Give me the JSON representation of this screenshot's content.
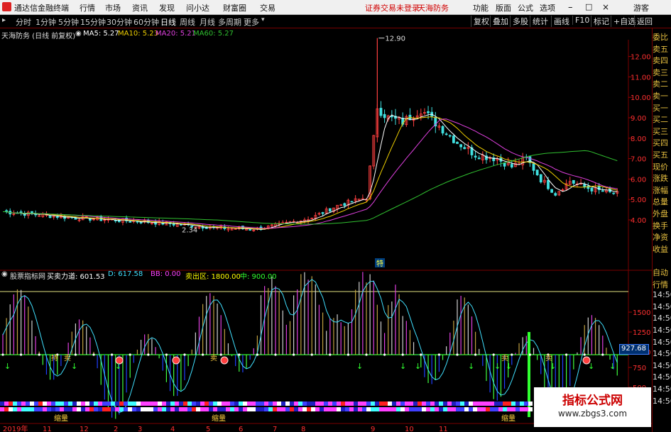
{
  "menu": {
    "app_name": "通达信金融终端",
    "items_left": [
      "行情",
      "市场",
      "资讯",
      "发现",
      "问小达",
      "财富圈",
      "交易"
    ],
    "notice": "证券交易未登录",
    "stock_name_top": "天海防务",
    "items_right": [
      "功能",
      "版面",
      "公式",
      "选项"
    ],
    "guest": "游客"
  },
  "periods": [
    "分时",
    "1分钟",
    "5分钟",
    "15分钟",
    "30分钟",
    "60分钟",
    "日线",
    "周线",
    "月线",
    "多周期",
    "更多"
  ],
  "active_period": "日线",
  "right_tools": [
    "复权",
    "叠加",
    "多股",
    "统计",
    "画线",
    "F10",
    "标记",
    "+自选",
    "返回"
  ],
  "main_chart": {
    "title": "天海防务 (日线 前复权)",
    "ma": [
      {
        "label": "MA5: 5.27",
        "color": "#ffffff"
      },
      {
        "label": "MA10: 5.23",
        "color": "#f0d000"
      },
      {
        "label": "MA20: 5.21",
        "color": "#e040e0"
      },
      {
        "label": "MA60: 5.27",
        "color": "#30c030"
      }
    ],
    "price_ticks": [
      "12.00",
      "11.00",
      "10.00",
      "9.00",
      "8.00",
      "7.00",
      "6.00",
      "5.00",
      "4.00"
    ],
    "high_label": "12.90",
    "low_label": "2.34",
    "event_label": "特"
  },
  "indicator": {
    "title": "股票指标网",
    "fields": [
      {
        "label": "买卖力道: 601.53",
        "color": "#ffffff"
      },
      {
        "label": "D: 617.58",
        "color": "#40e0ff"
      },
      {
        "label": "BB: 0.00",
        "color": "#ff40ff"
      },
      {
        "label": "卖出区: 1800.00",
        "color": "#ffff00"
      },
      {
        "label": "中: 900.00",
        "color": "#30ff30"
      }
    ],
    "value_ticks": [
      "1500",
      "1250",
      "1000",
      "750",
      "500"
    ],
    "current_value": "927.68",
    "signal_buy": "买",
    "signal_sell": "卖",
    "signal_hold": "持",
    "signal_vol": "缩量"
  },
  "timeline": {
    "labels": [
      "2019年",
      "11",
      "12",
      "2",
      "3",
      "4",
      "5",
      "6",
      "7",
      "8",
      "9",
      "10",
      "11"
    ]
  },
  "sidebar": [
    "委比",
    "卖五",
    "卖四",
    "卖三",
    "卖二",
    "卖一",
    "买一",
    "买二",
    "买三",
    "买四",
    "买五",
    "现价",
    "涨跌",
    "涨幅",
    "总量",
    "外盘",
    "换手",
    "净资",
    "收益",
    "",
    "自动",
    "行情",
    "14:50",
    "14:50",
    "14:50",
    "14:50",
    "14:50",
    "14:50",
    "14:50",
    "14:50",
    "14:50",
    "14:56"
  ],
  "watermark": {
    "title": "指标公式网",
    "url": "www.zbgs3.com"
  },
  "colors": {
    "up": "#ff4040",
    "down": "#40e0e0",
    "grid": "#7a0000",
    "axis_text": "#ff3030"
  }
}
